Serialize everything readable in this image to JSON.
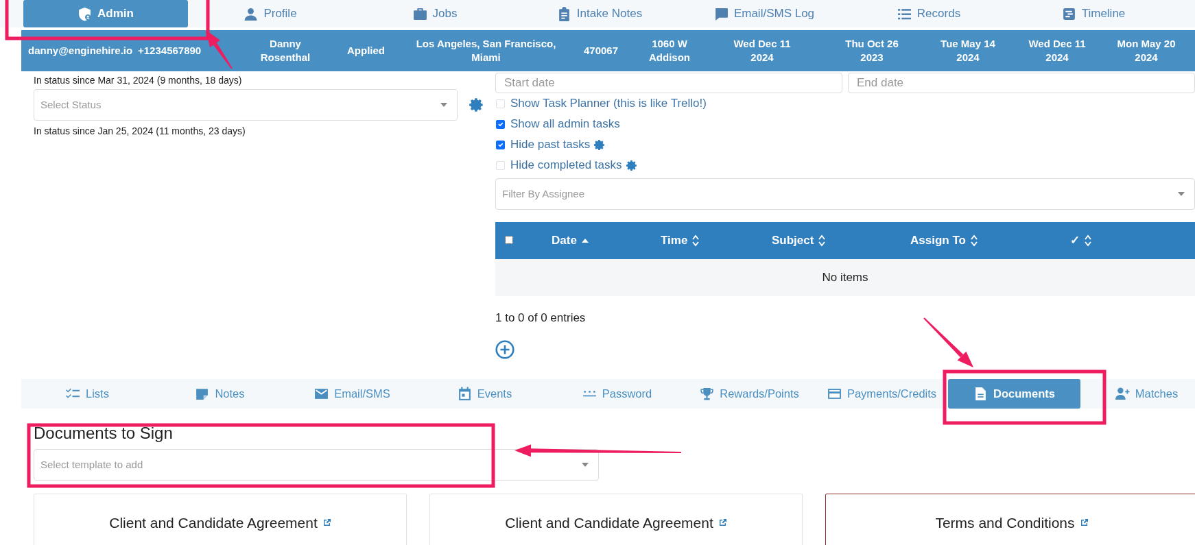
{
  "top_tabs": [
    {
      "label": "Admin",
      "selected": true
    },
    {
      "label": "Profile",
      "selected": false
    },
    {
      "label": "Jobs",
      "selected": false
    },
    {
      "label": "Intake Notes",
      "selected": false
    },
    {
      "label": "Email/SMS Log",
      "selected": false
    },
    {
      "label": "Records",
      "selected": false
    },
    {
      "label": "Timeline",
      "selected": false
    }
  ],
  "summary_ribbon": [
    "danny@enginehire.io",
    "+1234567890",
    "Danny Rosenthal",
    "Applied",
    "Los Angeles, San Francisco, Miami",
    "470067",
    "1060 W Addison",
    "Wed Dec 11 2024",
    "Thu Oct 26 2023",
    "Tue May 14 2024",
    "Wed Dec 11 2024",
    "Mon May 20 2024"
  ],
  "status_panel": {
    "since_text": "In status since Mar 31, 2024 (9 months, 18 days)",
    "select_placeholder": "Select Status",
    "since_text_2": "In status since Jan 25, 2024 (11 months, 23 days)"
  },
  "tasks": {
    "start_date_placeholder": "Start date",
    "end_date_placeholder": "End date",
    "options": [
      {
        "label": "Show Task Planner (this is like Trello!)",
        "checked": false,
        "has_settings": false
      },
      {
        "label": "Show all admin tasks",
        "checked": true,
        "has_settings": false
      },
      {
        "label": "Hide past tasks",
        "checked": true,
        "has_settings": true
      },
      {
        "label": "Hide completed tasks",
        "checked": false,
        "has_settings": true
      }
    ],
    "assignee_placeholder": "Filter By Assignee",
    "table": {
      "select_all_checked": false,
      "columns": [
        {
          "label": "Date",
          "sorted": true
        },
        {
          "label": "Time",
          "sorted": false
        },
        {
          "label": "Subject",
          "sorted": false
        },
        {
          "label": "Assign To",
          "sorted": false
        },
        {
          "label": "✓",
          "sorted": false
        }
      ],
      "empty_message": "No items"
    },
    "entries_text": "1 to 0 of 0 entries"
  },
  "bottom_tabs": [
    {
      "label": "Lists",
      "selected": false
    },
    {
      "label": "Notes",
      "selected": false
    },
    {
      "label": "Email/SMS",
      "selected": false
    },
    {
      "label": "Events",
      "selected": false
    },
    {
      "label": "Password",
      "selected": false
    },
    {
      "label": "Rewards/Points",
      "selected": false
    },
    {
      "label": "Payments/Credits",
      "selected": false
    },
    {
      "label": "Documents",
      "selected": true
    },
    {
      "label": "Matches",
      "selected": false
    }
  ],
  "documents": {
    "heading": "Documents to Sign",
    "template_placeholder": "Select template to add",
    "cards": [
      {
        "title": "Client and Candidate Agreement",
        "highlighted": false
      },
      {
        "title": "Client and Candidate Agreement",
        "highlighted": false
      },
      {
        "title": "Terms and Conditions",
        "highlighted": true
      }
    ]
  }
}
